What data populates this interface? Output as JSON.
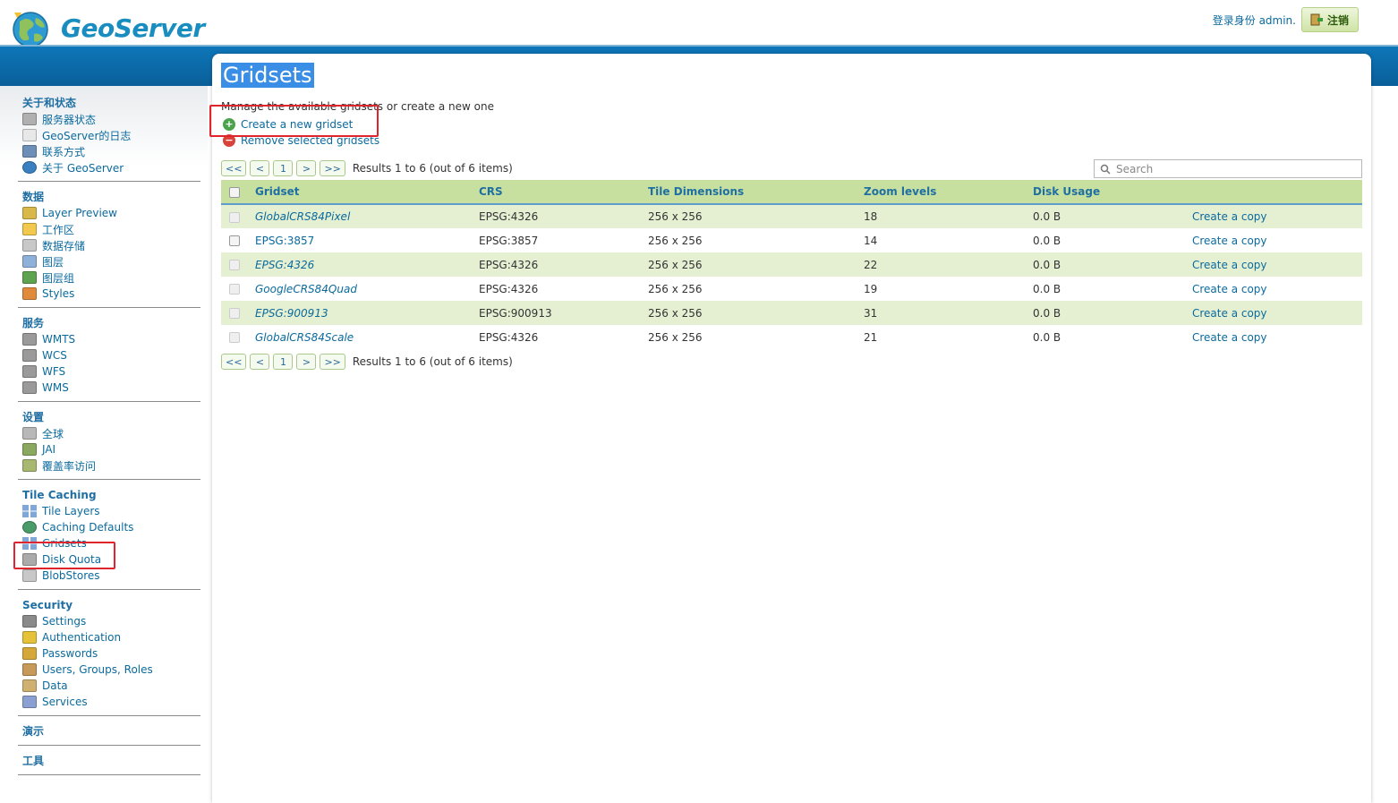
{
  "header": {
    "app_name": "GeoServer",
    "login_text": "登录身份 admin.",
    "logout_label": "注销"
  },
  "sidebar": {
    "sections": [
      {
        "title": "关于和状态",
        "items": [
          {
            "label": "服务器状态",
            "icon": "server-status-icon"
          },
          {
            "label": "GeoServer的日志",
            "icon": "log-icon"
          },
          {
            "label": "联系方式",
            "icon": "contact-icon"
          },
          {
            "label": "关于 GeoServer",
            "icon": "about-icon"
          }
        ]
      },
      {
        "title": "数据",
        "items": [
          {
            "label": "Layer Preview",
            "icon": "layer-preview-icon"
          },
          {
            "label": "工作区",
            "icon": "folder-icon"
          },
          {
            "label": "数据存储",
            "icon": "store-icon"
          },
          {
            "label": "图层",
            "icon": "layer-icon"
          },
          {
            "label": "图层组",
            "icon": "layergroup-icon"
          },
          {
            "label": "Styles",
            "icon": "styles-icon"
          }
        ]
      },
      {
        "title": "服务",
        "items": [
          {
            "label": "WMTS",
            "icon": "service-icon"
          },
          {
            "label": "WCS",
            "icon": "service-icon"
          },
          {
            "label": "WFS",
            "icon": "service-icon"
          },
          {
            "label": "WMS",
            "icon": "service-icon"
          }
        ]
      },
      {
        "title": "设置",
        "items": [
          {
            "label": "全球",
            "icon": "global-icon"
          },
          {
            "label": "JAI",
            "icon": "jai-icon"
          },
          {
            "label": "覆盖率访问",
            "icon": "coverage-icon"
          }
        ]
      },
      {
        "title": "Tile Caching",
        "items": [
          {
            "label": "Tile Layers",
            "icon": "grid-icon"
          },
          {
            "label": "Caching Defaults",
            "icon": "globe-icon"
          },
          {
            "label": "Gridsets",
            "icon": "grid-icon"
          },
          {
            "label": "Disk Quota",
            "icon": "disk-icon"
          },
          {
            "label": "BlobStores",
            "icon": "store-icon"
          }
        ]
      },
      {
        "title": "Security",
        "items": [
          {
            "label": "Settings",
            "icon": "wrench-icon"
          },
          {
            "label": "Authentication",
            "icon": "shield-icon"
          },
          {
            "label": "Passwords",
            "icon": "lock-icon"
          },
          {
            "label": "Users, Groups, Roles",
            "icon": "users-icon"
          },
          {
            "label": "Data",
            "icon": "data-security-icon"
          },
          {
            "label": "Services",
            "icon": "services-security-icon"
          }
        ]
      },
      {
        "title": "演示",
        "items": []
      },
      {
        "title": "工具",
        "items": []
      }
    ]
  },
  "main": {
    "title": "Gridsets",
    "description": "Manage the available gridsets or create a new one",
    "create_label": "Create a new gridset",
    "remove_label": "Remove selected gridsets",
    "pager": {
      "first": "<<",
      "prev": "<",
      "page": "1",
      "next": ">",
      "last": ">>",
      "results": "Results 1 to 6 (out of 6 items)"
    },
    "search_placeholder": "Search",
    "columns": [
      "Gridset",
      "CRS",
      "Tile Dimensions",
      "Zoom levels",
      "Disk Usage"
    ],
    "rows": [
      {
        "name": "GlobalCRS84Pixel",
        "italic": true,
        "crs": "EPSG:4326",
        "tiles": "256 x 256",
        "zoom": "18",
        "disk": "0.0 B",
        "action": "Create a copy"
      },
      {
        "name": "EPSG:3857",
        "italic": false,
        "crs": "EPSG:3857",
        "tiles": "256 x 256",
        "zoom": "14",
        "disk": "0.0 B",
        "action": "Create a copy"
      },
      {
        "name": "EPSG:4326",
        "italic": true,
        "crs": "EPSG:4326",
        "tiles": "256 x 256",
        "zoom": "22",
        "disk": "0.0 B",
        "action": "Create a copy"
      },
      {
        "name": "GoogleCRS84Quad",
        "italic": true,
        "crs": "EPSG:4326",
        "tiles": "256 x 256",
        "zoom": "19",
        "disk": "0.0 B",
        "action": "Create a copy"
      },
      {
        "name": "EPSG:900913",
        "italic": true,
        "crs": "EPSG:900913",
        "tiles": "256 x 256",
        "zoom": "31",
        "disk": "0.0 B",
        "action": "Create a copy"
      },
      {
        "name": "GlobalCRS84Scale",
        "italic": true,
        "crs": "EPSG:4326",
        "tiles": "256 x 256",
        "zoom": "21",
        "disk": "0.0 B",
        "action": "Create a copy"
      }
    ]
  },
  "colors": {
    "accent": "#0b6a9d",
    "header_band": "#0e76b8",
    "table_header": "#c7e09f",
    "row_alt": "#e5f0d3",
    "highlight_box": "#e0242b"
  }
}
